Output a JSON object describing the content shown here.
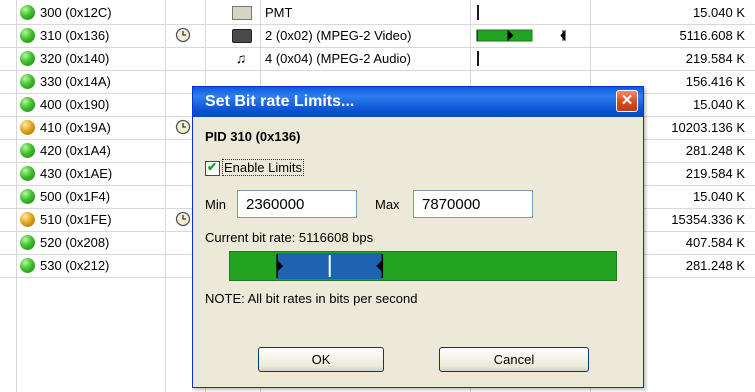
{
  "table": {
    "rows": [
      {
        "pid": "300 (0x12C)",
        "status": "green",
        "clock": false,
        "type_icon": "table-icon",
        "type": "PMT",
        "rate": "15.040 K",
        "bar": "line"
      },
      {
        "pid": "310 (0x136)",
        "status": "green",
        "clock": true,
        "type_icon": "video-icon",
        "type": "2 (0x02) (MPEG-2 Video)",
        "rate": "5116.608 K",
        "bar": "green"
      },
      {
        "pid": "320 (0x140)",
        "status": "green",
        "clock": false,
        "type_icon": "music-note-icon",
        "type": "4 (0x04) (MPEG-2 Audio)",
        "rate": "219.584 K",
        "bar": "line"
      },
      {
        "pid": "330 (0x14A)",
        "status": "green",
        "clock": false,
        "type_icon": "",
        "type": "",
        "rate": "156.416 K",
        "bar": "none"
      },
      {
        "pid": "400 (0x190)",
        "status": "green",
        "clock": false,
        "type_icon": "",
        "type": "",
        "rate": "15.040 K",
        "bar": "none"
      },
      {
        "pid": "410 (0x19A)",
        "status": "yellow",
        "clock": true,
        "type_icon": "",
        "type": "",
        "rate": "10203.136 K",
        "bar": "none"
      },
      {
        "pid": "420 (0x1A4)",
        "status": "green",
        "clock": false,
        "type_icon": "",
        "type": "",
        "rate": "281.248 K",
        "bar": "none"
      },
      {
        "pid": "430 (0x1AE)",
        "status": "green",
        "clock": false,
        "type_icon": "",
        "type": "",
        "rate": "219.584 K",
        "bar": "none"
      },
      {
        "pid": "500 (0x1F4)",
        "status": "green",
        "clock": false,
        "type_icon": "",
        "type": "",
        "rate": "15.040 K",
        "bar": "none"
      },
      {
        "pid": "510 (0x1FE)",
        "status": "yellow",
        "clock": true,
        "type_icon": "",
        "type": "",
        "rate": "15354.336 K",
        "bar": "none"
      },
      {
        "pid": "520 (0x208)",
        "status": "green",
        "clock": false,
        "type_icon": "",
        "type": "",
        "rate": "407.584 K",
        "bar": "none"
      },
      {
        "pid": "530 (0x212)",
        "status": "green",
        "clock": false,
        "type_icon": "",
        "type": "",
        "rate": "281.248 K",
        "bar": "none"
      }
    ]
  },
  "dialog": {
    "title": "Set Bit rate Limits...",
    "close_icon": "close-icon",
    "pid_label": "PID 310 (0x136)",
    "enable_label": "Enable Limits",
    "enable_checked": true,
    "min_label": "Min",
    "min_value": "2360000",
    "max_label": "Max",
    "max_value": "7870000",
    "current_rate": "Current bit rate: 5116608 bps",
    "note": "NOTE: All bit rates in bits per second",
    "ok_label": "OK",
    "cancel_label": "Cancel",
    "limits_bar": {
      "scale_max": 20000000,
      "min": 2360000,
      "max": 7870000,
      "current": 5116608
    },
    "colors": {
      "bar_fill": "#22a322",
      "title_bar": "#0a5cd8"
    }
  }
}
